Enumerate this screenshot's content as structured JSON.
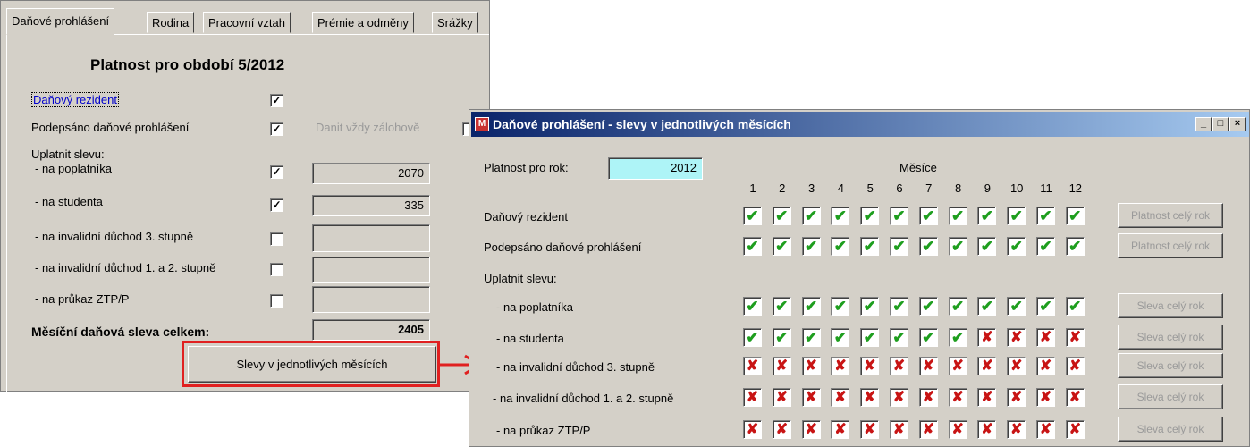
{
  "main": {
    "tabs": [
      "Daňové prohlášení",
      "Rodina",
      "Pracovní vztah",
      "Prémie a odměny",
      "Srážky"
    ],
    "heading": "Platnost pro období 5/2012",
    "resident_label": "Daňový rezident",
    "resident_checked": true,
    "signed_label": "Podepsáno daňové prohlášení",
    "signed_checked": true,
    "always_advance_label": "Danit vždy zálohově",
    "apply_label": "Uplatnit slevu:",
    "rows": [
      {
        "label": "- na poplatníka",
        "checked": true,
        "value": "2070"
      },
      {
        "label": "- na studenta",
        "checked": true,
        "value": "335"
      },
      {
        "label": "- na invalidní důchod 3. stupně",
        "checked": false,
        "value": ""
      },
      {
        "label": "- na invalidní důchod 1. a 2. stupně",
        "checked": false,
        "value": ""
      },
      {
        "label": "- na průkaz ZTP/P",
        "checked": false,
        "value": ""
      }
    ],
    "total_label": "Měsíční daňová sleva celkem:",
    "total_value": "2405",
    "months_button": "Slevy v jednotlivých měsících"
  },
  "dialog": {
    "title": "Daňové prohlášení - slevy v jednotlivých  měsících",
    "min_label": "_",
    "max_label": "□",
    "close_label": "×",
    "year_label": "Platnost pro rok:",
    "year_value": "2012",
    "months_label": "Měsíce",
    "months": [
      "1",
      "2",
      "3",
      "4",
      "5",
      "6",
      "7",
      "8",
      "9",
      "10",
      "11",
      "12"
    ],
    "apply_label": "Uplatnit slevu:",
    "grid": [
      {
        "label": "Daňový rezident",
        "button": "Platnost celý rok",
        "marks": [
          1,
          1,
          1,
          1,
          1,
          1,
          1,
          1,
          1,
          1,
          1,
          1
        ]
      },
      {
        "label": "Podepsáno daňové prohlášení",
        "button": "Platnost celý rok",
        "marks": [
          1,
          1,
          1,
          1,
          1,
          1,
          1,
          1,
          1,
          1,
          1,
          1
        ]
      },
      {
        "label": "- na poplatníka",
        "button": "Sleva celý rok",
        "marks": [
          1,
          1,
          1,
          1,
          1,
          1,
          1,
          1,
          1,
          1,
          1,
          1
        ]
      },
      {
        "label": "- na studenta",
        "button": "Sleva celý rok",
        "marks": [
          1,
          1,
          1,
          1,
          1,
          1,
          1,
          1,
          0,
          0,
          0,
          0
        ]
      },
      {
        "label": "- na invalidní důchod 3. stupně",
        "button": "Sleva celý rok",
        "marks": [
          0,
          0,
          0,
          0,
          0,
          0,
          0,
          0,
          0,
          0,
          0,
          0
        ]
      },
      {
        "label": "- na invalidní důchod 1. a 2. stupně",
        "button": "Sleva celý rok",
        "marks": [
          0,
          0,
          0,
          0,
          0,
          0,
          0,
          0,
          0,
          0,
          0,
          0
        ]
      },
      {
        "label": "- na průkaz ZTP/P",
        "button": "Sleva celý rok",
        "marks": [
          0,
          0,
          0,
          0,
          0,
          0,
          0,
          0,
          0,
          0,
          0,
          0
        ]
      }
    ]
  },
  "colors": {
    "highlight": "#e02020",
    "ok": "#1e9e1e",
    "no": "#c81414",
    "year_field": "#aef4f7"
  }
}
